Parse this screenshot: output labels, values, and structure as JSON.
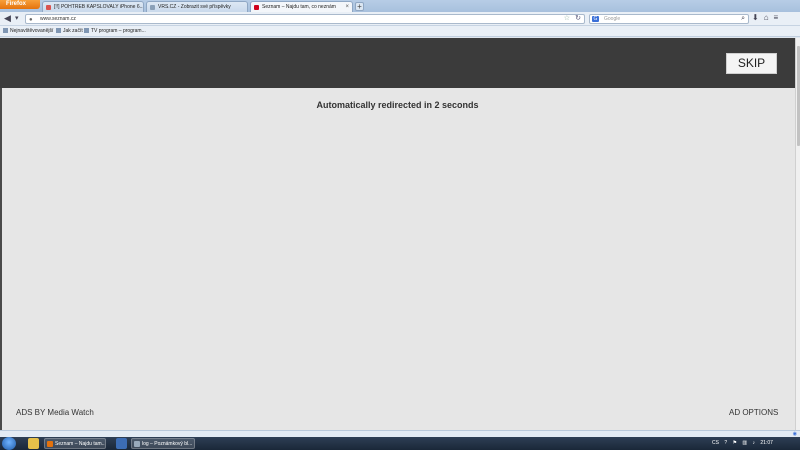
{
  "browser": {
    "menu_button": "Firefox",
    "tabs": [
      {
        "label": "[!!] POHTREB KAPSLOVALY iPhone 6...",
        "favicon_color": "#d9534f",
        "active": false
      },
      {
        "label": "VRS.CZ - Zobrazit své příspěvky",
        "favicon_color": "#8aa0b8",
        "active": false
      },
      {
        "label": "Seznam – Najdu tam, co neznám",
        "favicon_color": "#d0021b",
        "active": true
      }
    ],
    "new_tab": "+",
    "url": "www.seznam.cz",
    "search_placeholder": "Google",
    "search_engine_letter": "G",
    "bookmarks": [
      {
        "label": "Nejnavštěvovanější"
      },
      {
        "label": "Jak začít"
      },
      {
        "label": "TV program – program..."
      }
    ]
  },
  "page": {
    "skip_label": "SKIP",
    "redirect_text": "Automatically redirected in 2 seconds",
    "ads_by_text": "ADS BY Media Watch",
    "ad_options_text": "AD OPTIONS"
  },
  "taskbar": {
    "items": [
      {
        "label": "Seznam – Najdu tam...",
        "icon_color": "#e4720c"
      },
      {
        "label": "log – Poznámkový bl...",
        "icon_color": "#9ab"
      }
    ],
    "tray": {
      "language": "CS",
      "time": "21:07"
    }
  },
  "colors": {
    "header_bar": "#3b3b3b",
    "page_background": "#e6e6e6",
    "skip_button": "#f4f4f4"
  }
}
